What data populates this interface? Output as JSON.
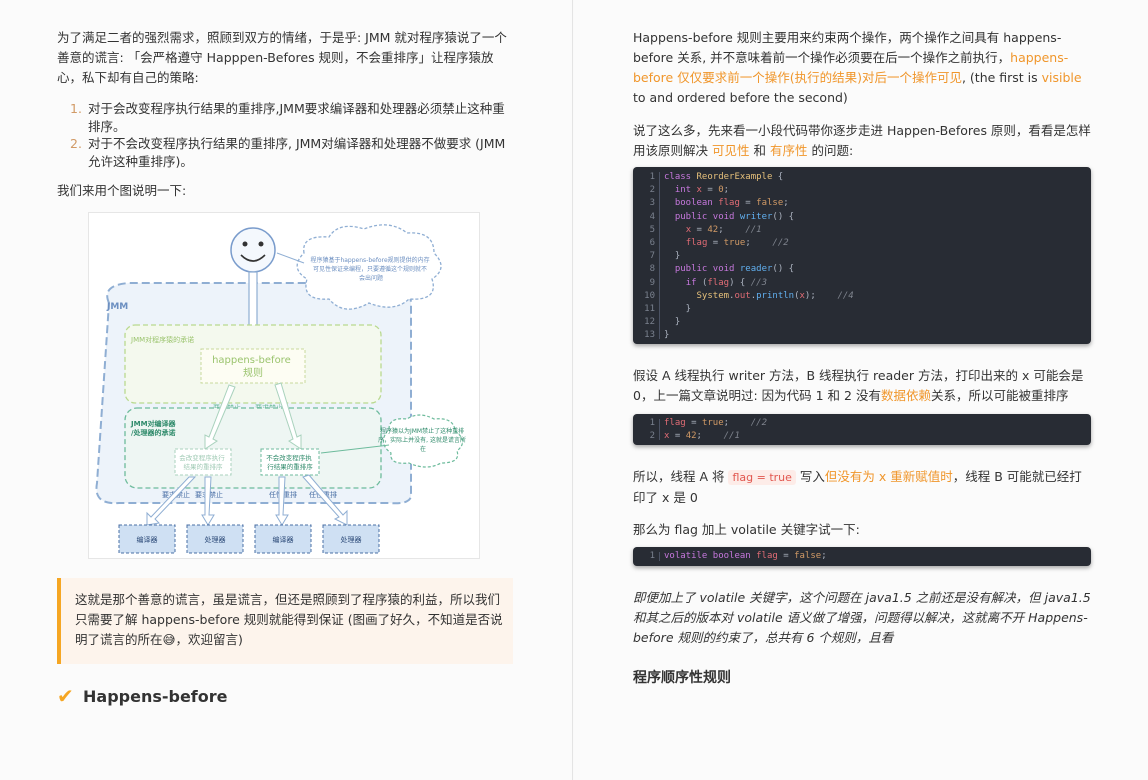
{
  "left": {
    "intro": "为了满足二者的强烈需求，照顾到双方的情绪，于是乎: JMM 就对程序猿说了一个善意的谎言: 「会严格遵守 Happpen-Befores 规则，不会重排序」让程序猿放心，私下却有自己的策略:",
    "list": [
      {
        "num": "1.",
        "text": "对于会改变程序执行结果的重排序,JMM要求编译器和处理器必须禁止这种重排序。"
      },
      {
        "num": "2.",
        "text": "对于不会改变程序执行结果的重排序, JMM对编译器和处理器不做要求 (JMM允许这种重排序)。"
      }
    ],
    "figure_intro": "我们来用个图说明一下:",
    "figure": {
      "cloud_top": "程序猿基于happens-before规则提供的内存可见性保证来编程，只要遵循这个规则就不会出问题",
      "jmm": "JMM",
      "promise_to_programmer": "JMM对程序猿的承诺",
      "hb_rule": "happens-before\n规则",
      "req_forbid_1": "要求禁止",
      "req_forbid_2": "要求禁止",
      "promise_to_compiler": "JMM对编译器\n/处理器的承诺",
      "change_result": "会改变程序执行\n结果的重排序",
      "no_change_result": "不会改变程序执\n行结果的重排序",
      "cloud_right": "程序猿以为JMM禁止了这种重排序，实际上并没有, 这就是谎言所在",
      "bottom_labels": [
        "要求禁止",
        "要求禁止",
        "任性重排",
        "任性重排"
      ],
      "boxes": [
        "编译器",
        "处理器",
        "编译器",
        "处理器"
      ]
    },
    "quote": "这就是那个善意的谎言，虽是谎言，但还是照顾到了程序猿的利益，所以我们只需要了解 happens-before 规则就能得到保证 (图画了好久，不知道是否说明了谎言的所在😅，欢迎留言)",
    "heading": "Happens-before"
  },
  "right": {
    "p1_a": "Happens-before 规则主要用来约束两个操作，两个操作之间具有 happens-before 关系, 并不意味着前一个操作必须要在后一个操作之前执行，",
    "p1_hl": "happens-before 仅仅要求前一个操作(执行的结果)对后一个操作可见",
    "p1_b": ", (the first is ",
    "p1_visible": "visible",
    "p1_c": " to and ordered before the second)",
    "p2_a": "说了这么多，先来看一小段代码带你逐步走进 Happen-Befores 原则，看看是怎样用该原则解决 ",
    "p2_hl1": "可见性",
    "p2_mid": " 和 ",
    "p2_hl2": "有序性",
    "p2_b": " 的问题:",
    "code1_lines": [
      "1",
      "2",
      "3",
      "4",
      "5",
      "6",
      "7",
      "8",
      "9",
      "10",
      "11",
      "12",
      "13"
    ],
    "p3_a": "假设 A 线程执行 writer 方法，B 线程执行 reader 方法，打印出来的 x 可能会是 0，上一篇文章说明过: 因为代码 1 和 2 没有",
    "p3_hl": "数据依赖",
    "p3_b": "关系，所以可能被重排序",
    "p4_a": "所以，线程 A 将 ",
    "p4_code": "flag = true",
    "p4_b": " 写入",
    "p4_hl": "但没有为 x 重新赋值时",
    "p4_c": "，线程 B 可能就已经打印了 x 是 0",
    "p5": "那么为 flag 加上 volatile 关键字试一下:",
    "p6": "即便加上了 volatile 关键字，这个问题在 java1.5 之前还是没有解决，但 java1.5 和其之后的版本对 volatile 语义做了增强，问题得以解决，这就离不开 Happens-before 规则的约束了，总共有 6 个规则，且看",
    "heading": "程序顺序性规则"
  },
  "colors": {
    "accent": "#f0962b",
    "code_bg": "#282c34",
    "quote_border": "#f5a623"
  }
}
